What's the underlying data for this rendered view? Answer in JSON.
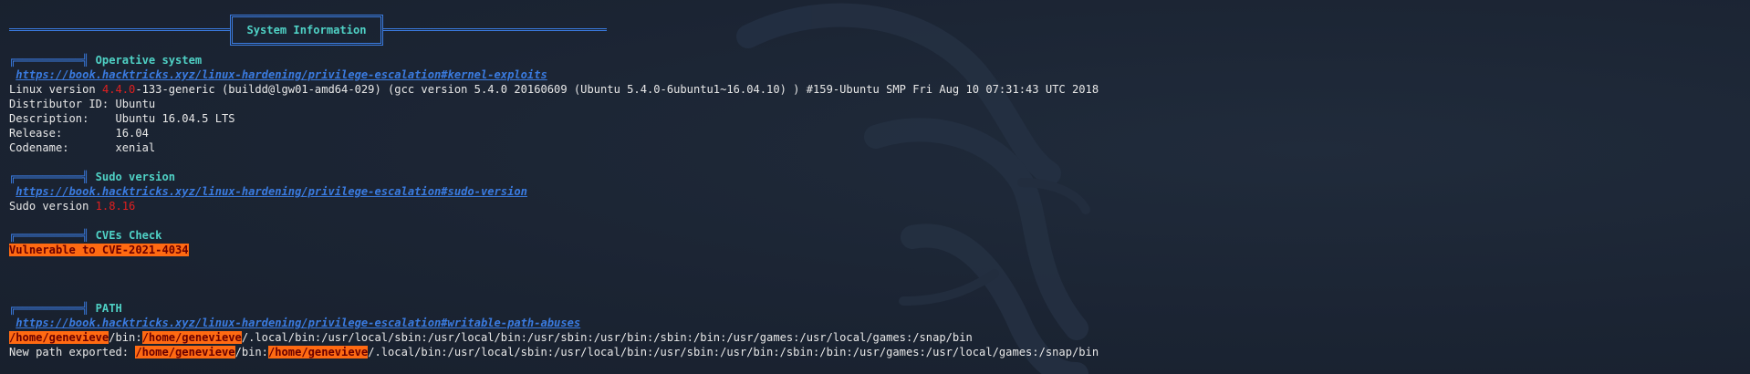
{
  "header": {
    "title": "System Information"
  },
  "sections": {
    "os": {
      "glyph": "╔══════════╣",
      "title": "Operative system",
      "link": "https://book.hacktricks.xyz/linux-hardening/privilege-escalation#kernel-exploits",
      "kernel_prefix": "Linux version ",
      "kernel_version": "4.4.0",
      "kernel_suffix": "-133-generic (buildd@lgw01-amd64-029) (gcc version 5.4.0 20160609 (Ubuntu 5.4.0-6ubuntu1~16.04.10) ) #159-Ubuntu SMP Fri Aug 10 07:31:43 UTC 2018",
      "distributor": "Distributor ID: Ubuntu",
      "description": "Description:    Ubuntu 16.04.5 LTS",
      "release": "Release:        16.04",
      "codename": "Codename:       xenial"
    },
    "sudo": {
      "glyph": "╔══════════╣",
      "title": "Sudo version",
      "link": "https://book.hacktricks.xyz/linux-hardening/privilege-escalation#sudo-version",
      "prefix": "Sudo version ",
      "version": "1.8.16"
    },
    "cves": {
      "glyph": "╔══════════╣",
      "title": "CVEs Check",
      "vuln": "Vulnerable to CVE-2021-4034"
    },
    "path": {
      "glyph": "╔══════════╣",
      "title": "PATH",
      "link": "https://book.hacktricks.xyz/linux-hardening/privilege-escalation#writable-path-abuses",
      "home": "/home/genevieve",
      "l1_seg1": "/bin:",
      "l1_seg2": "/.local/bin:/usr/local/sbin:/usr/local/bin:/usr/sbin:/usr/bin:/sbin:/bin:/usr/games:/usr/local/games:/snap/bin",
      "exported_prefix": "New path exported: ",
      "l2_seg1": "/bin:",
      "l2_seg2": "/.local/bin:/usr/local/sbin:/usr/local/bin:/usr/sbin:/usr/bin:/sbin:/bin:/usr/games:/usr/local/games:/snap/bin"
    }
  },
  "colors": {
    "background": "#1b2433",
    "accent_blue": "#3a7be0",
    "accent_teal": "#4fd1c5",
    "highlight_red": "#e02020",
    "highlight_orange": "#ff6a12"
  }
}
